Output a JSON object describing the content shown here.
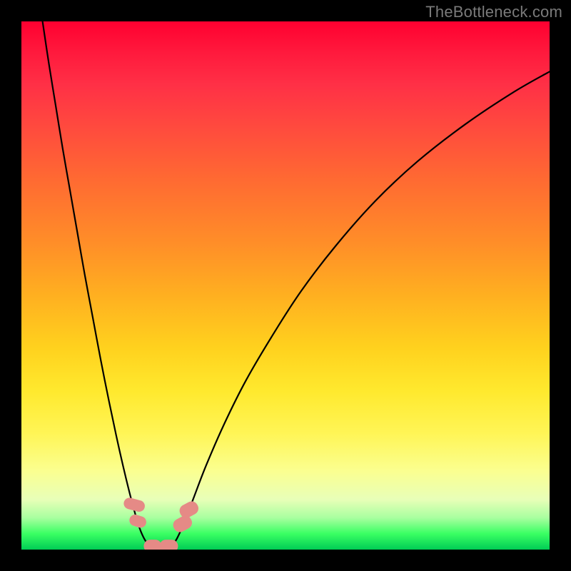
{
  "watermark": "TheBottleneck.com",
  "chart_data": {
    "type": "line",
    "title": "",
    "xlabel": "",
    "ylabel": "",
    "xlim": [
      0,
      100
    ],
    "ylim": [
      0,
      100
    ],
    "background_gradient_stops": [
      {
        "pos": 0,
        "color": "#ff0030"
      },
      {
        "pos": 6,
        "color": "#ff1a3d"
      },
      {
        "pos": 12,
        "color": "#ff3046"
      },
      {
        "pos": 20,
        "color": "#ff4a3e"
      },
      {
        "pos": 30,
        "color": "#ff6a32"
      },
      {
        "pos": 42,
        "color": "#ff8e28"
      },
      {
        "pos": 52,
        "color": "#ffb020"
      },
      {
        "pos": 62,
        "color": "#ffd21e"
      },
      {
        "pos": 70,
        "color": "#ffe92e"
      },
      {
        "pos": 78,
        "color": "#fff556"
      },
      {
        "pos": 85,
        "color": "#fbff8f"
      },
      {
        "pos": 90.5,
        "color": "#e8ffb8"
      },
      {
        "pos": 94,
        "color": "#a8ff9f"
      },
      {
        "pos": 97,
        "color": "#3aff63"
      },
      {
        "pos": 100,
        "color": "#00cc55"
      }
    ],
    "series": [
      {
        "name": "left-branch",
        "color": "#000000",
        "stroke_width": 2,
        "points": [
          {
            "x": 4.0,
            "y": 100.0
          },
          {
            "x": 5.2,
            "y": 92.0
          },
          {
            "x": 6.5,
            "y": 84.0
          },
          {
            "x": 7.8,
            "y": 76.0
          },
          {
            "x": 9.2,
            "y": 68.0
          },
          {
            "x": 10.6,
            "y": 60.0
          },
          {
            "x": 12.0,
            "y": 52.0
          },
          {
            "x": 13.5,
            "y": 44.0
          },
          {
            "x": 15.0,
            "y": 36.0
          },
          {
            "x": 16.6,
            "y": 28.0
          },
          {
            "x": 18.3,
            "y": 20.0
          },
          {
            "x": 19.8,
            "y": 13.5
          },
          {
            "x": 21.2,
            "y": 8.0
          },
          {
            "x": 22.4,
            "y": 4.0
          },
          {
            "x": 23.4,
            "y": 1.8
          },
          {
            "x": 24.4,
            "y": 0.6
          },
          {
            "x": 25.4,
            "y": 0.2
          }
        ]
      },
      {
        "name": "right-branch",
        "color": "#000000",
        "stroke_width": 2,
        "points": [
          {
            "x": 27.6,
            "y": 0.2
          },
          {
            "x": 28.4,
            "y": 0.6
          },
          {
            "x": 29.4,
            "y": 2.0
          },
          {
            "x": 30.6,
            "y": 4.6
          },
          {
            "x": 32.5,
            "y": 9.5
          },
          {
            "x": 35.0,
            "y": 16.0
          },
          {
            "x": 38.5,
            "y": 24.0
          },
          {
            "x": 42.5,
            "y": 32.0
          },
          {
            "x": 47.5,
            "y": 40.5
          },
          {
            "x": 53.0,
            "y": 49.0
          },
          {
            "x": 59.5,
            "y": 57.5
          },
          {
            "x": 67.0,
            "y": 66.0
          },
          {
            "x": 75.0,
            "y": 73.5
          },
          {
            "x": 84.0,
            "y": 80.5
          },
          {
            "x": 93.0,
            "y": 86.5
          },
          {
            "x": 100.0,
            "y": 90.5
          }
        ]
      }
    ],
    "markers": [
      {
        "x": 21.3,
        "y": 8.5,
        "w": 2.2,
        "h": 4.0,
        "rot": -75
      },
      {
        "x": 22.0,
        "y": 5.4,
        "w": 2.2,
        "h": 3.2,
        "rot": -72
      },
      {
        "x": 24.9,
        "y": 0.7,
        "w": 3.4,
        "h": 2.4,
        "rot": 0
      },
      {
        "x": 27.9,
        "y": 0.7,
        "w": 3.4,
        "h": 2.4,
        "rot": 0
      },
      {
        "x": 30.6,
        "y": 4.8,
        "w": 2.6,
        "h": 3.6,
        "rot": 62
      },
      {
        "x": 31.8,
        "y": 7.6,
        "w": 2.6,
        "h": 3.6,
        "rot": 62
      }
    ]
  }
}
